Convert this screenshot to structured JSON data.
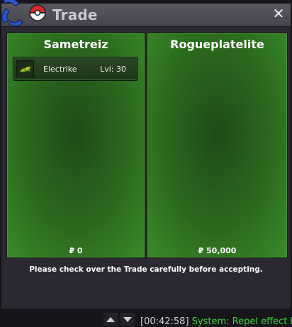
{
  "window": {
    "title": "Trade",
    "close_glyph": "✕"
  },
  "left_panel": {
    "player_name": "Sametreiz",
    "money": "₽ 0",
    "items": [
      {
        "name": "Electrike",
        "level": "Lvl: 30",
        "icon": "electrike-sprite-icon"
      }
    ]
  },
  "right_panel": {
    "player_name": "Rogueplatelite",
    "money": "₽ 50,000"
  },
  "notice": "Please check over the Trade carefully before accepting.",
  "chat": {
    "timestamp": "[00:42:58]",
    "prefix": "System:",
    "message": "Repel effect has"
  },
  "colors": {
    "panel_green": "#2b6a1e",
    "window_bg": "#2b2a33",
    "titlebar": "#4f4e56",
    "system_text": "#3fd13f"
  }
}
